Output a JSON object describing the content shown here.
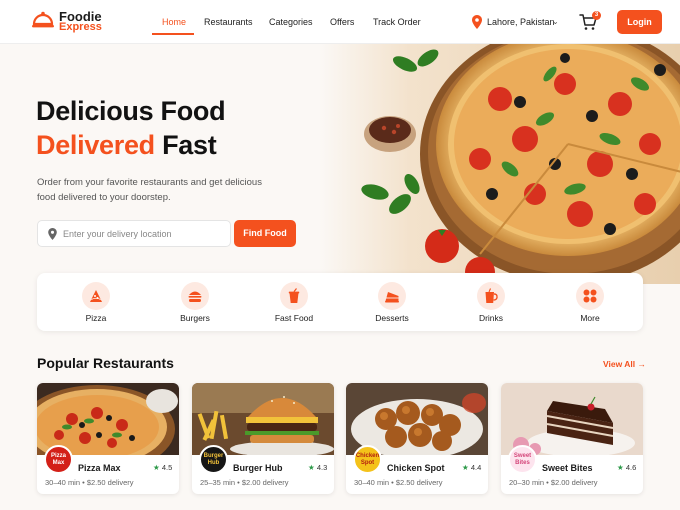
{
  "brand": {
    "line1": "Foodie",
    "line2": "Express",
    "accent": "#f4511e"
  },
  "nav": {
    "links": [
      {
        "label": "Home",
        "active": true
      },
      {
        "label": "Restaurants"
      },
      {
        "label": "Categories"
      },
      {
        "label": "Offers"
      },
      {
        "label": "Track Order"
      }
    ],
    "location": "Lahore, Pakistan",
    "cart_count": "3",
    "login_label": "Login"
  },
  "hero": {
    "title_line1": "Delicious Food",
    "title_accent": "Delivered",
    "title_rest": "Fast",
    "subtitle": "Order from your favorite restaurants and get delicious food delivered to your doorstep.",
    "search_placeholder": "Enter your delivery location",
    "find_label": "Find Food"
  },
  "categories": [
    {
      "label": "Pizza",
      "icon": "pizza-icon"
    },
    {
      "label": "Burgers",
      "icon": "burger-icon"
    },
    {
      "label": "Fast Food",
      "icon": "drink-cup-icon"
    },
    {
      "label": "Desserts",
      "icon": "cake-icon"
    },
    {
      "label": "Drinks",
      "icon": "mug-icon"
    },
    {
      "label": "More",
      "icon": "grid-dots-icon"
    }
  ],
  "popular": {
    "title": "Popular Restaurants",
    "view_all": "View All →",
    "restaurants": [
      {
        "name": "Pizza Max",
        "rating": "4.5",
        "meta": "30–40 min • $2.50 delivery",
        "logo_text": "Pizza Max"
      },
      {
        "name": "Burger Hub",
        "rating": "4.3",
        "meta": "25–35 min • $2.00 delivery",
        "logo_text": "Burger Hub"
      },
      {
        "name": "Chicken Spot",
        "rating": "4.4",
        "meta": "30–40 min • $2.50 delivery",
        "logo_text": "Chicken Spot"
      },
      {
        "name": "Sweet Bites",
        "rating": "4.6",
        "meta": "20–30 min • $2.00 delivery",
        "logo_text": "Sweet Bites"
      }
    ]
  }
}
